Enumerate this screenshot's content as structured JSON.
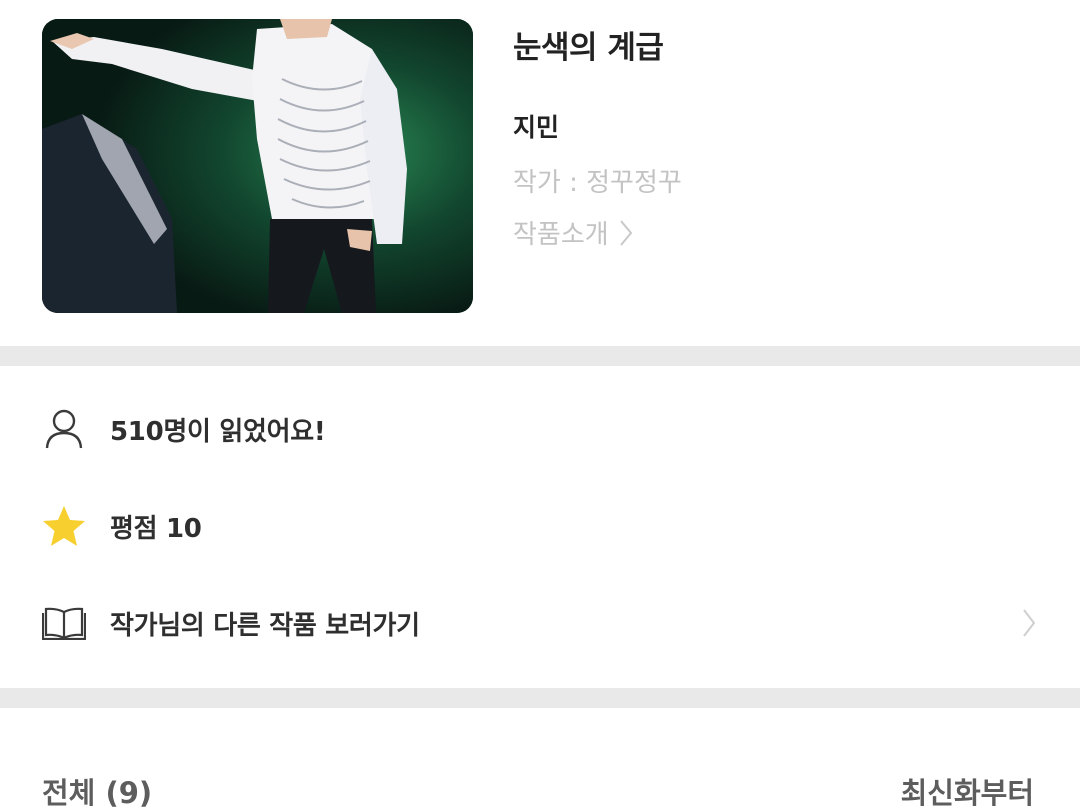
{
  "work": {
    "title": "눈색의 계급",
    "subject": "지민",
    "author_line": "작가 : 정꾸정꾸",
    "intro_label": "작품소개"
  },
  "info": {
    "readers": "510명이 읽었어요!",
    "rating": "평점 10",
    "other_works": "작가님의 다른 작품 보러가기"
  },
  "episodes": {
    "total_label": "전체 (9)",
    "sort_label": "최신화부터"
  },
  "icons": {
    "readers": "user-icon",
    "rating": "star-icon",
    "other_works": "book-icon",
    "chevron": "chevron-right-icon"
  },
  "colors": {
    "star": "#f7cf2e",
    "muted_text": "#c3c3c3",
    "divider": "#e9e9e9"
  }
}
